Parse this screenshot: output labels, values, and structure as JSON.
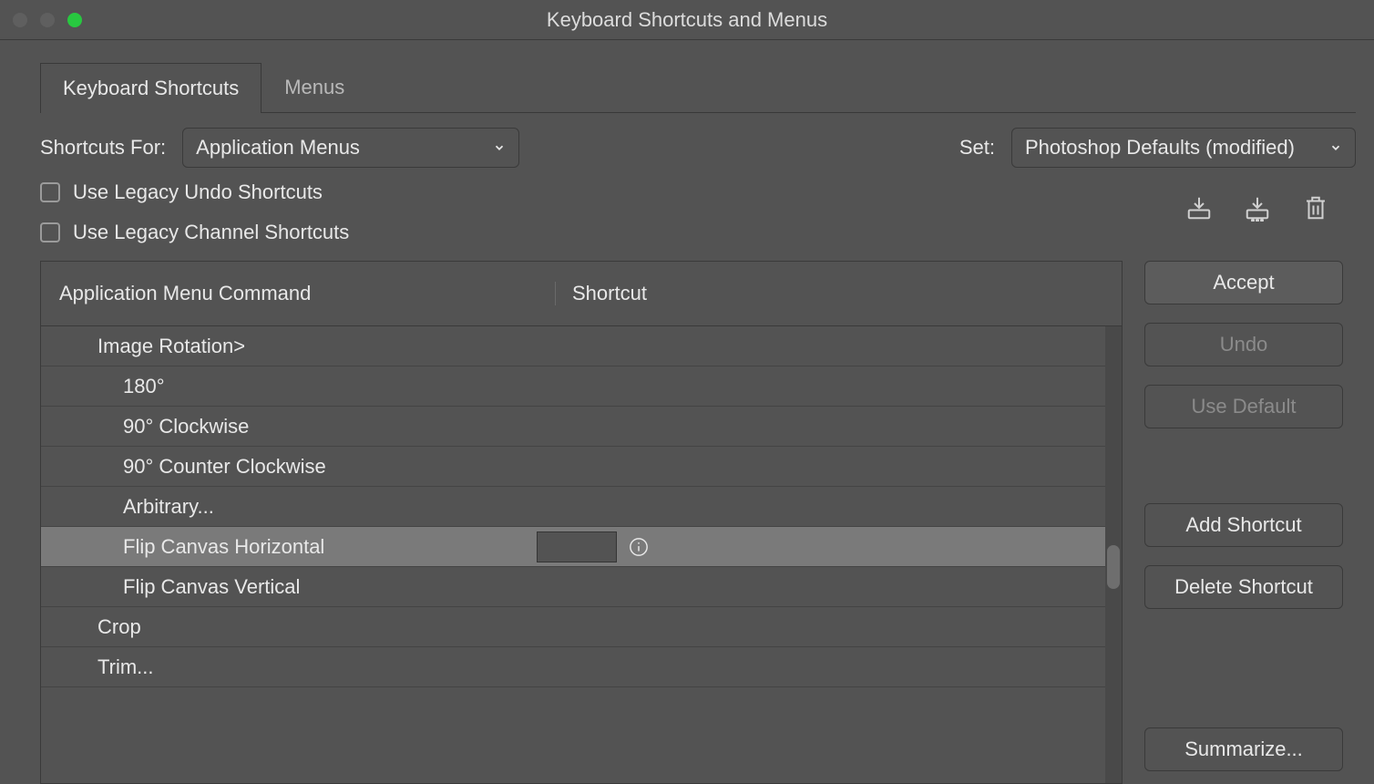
{
  "window_title": "Keyboard Shortcuts and Menus",
  "tabs": {
    "shortcuts": "Keyboard Shortcuts",
    "menus": "Menus"
  },
  "shortcuts_for_label": "Shortcuts For:",
  "shortcuts_for_value": "Application Menus",
  "set_label": "Set:",
  "set_value": "Photoshop Defaults (modified)",
  "legacy_undo": "Use Legacy Undo Shortcuts",
  "legacy_channel": "Use Legacy Channel Shortcuts",
  "columns": {
    "command": "Application Menu Command",
    "shortcut": "Shortcut"
  },
  "rows": [
    {
      "label": "Image Rotation>",
      "indent": 0,
      "selected": false
    },
    {
      "label": "180°",
      "indent": 1,
      "selected": false
    },
    {
      "label": "90° Clockwise",
      "indent": 1,
      "selected": false
    },
    {
      "label": "90° Counter Clockwise",
      "indent": 1,
      "selected": false
    },
    {
      "label": "Arbitrary...",
      "indent": 1,
      "selected": false
    },
    {
      "label": "Flip Canvas Horizontal",
      "indent": 1,
      "selected": true
    },
    {
      "label": "Flip Canvas Vertical",
      "indent": 1,
      "selected": false
    },
    {
      "label": "Crop",
      "indent": 0,
      "selected": false
    },
    {
      "label": "Trim...",
      "indent": 0,
      "selected": false
    }
  ],
  "buttons": {
    "accept": "Accept",
    "undo": "Undo",
    "use_default": "Use Default",
    "add": "Add Shortcut",
    "delete": "Delete Shortcut",
    "summarize": "Summarize..."
  }
}
